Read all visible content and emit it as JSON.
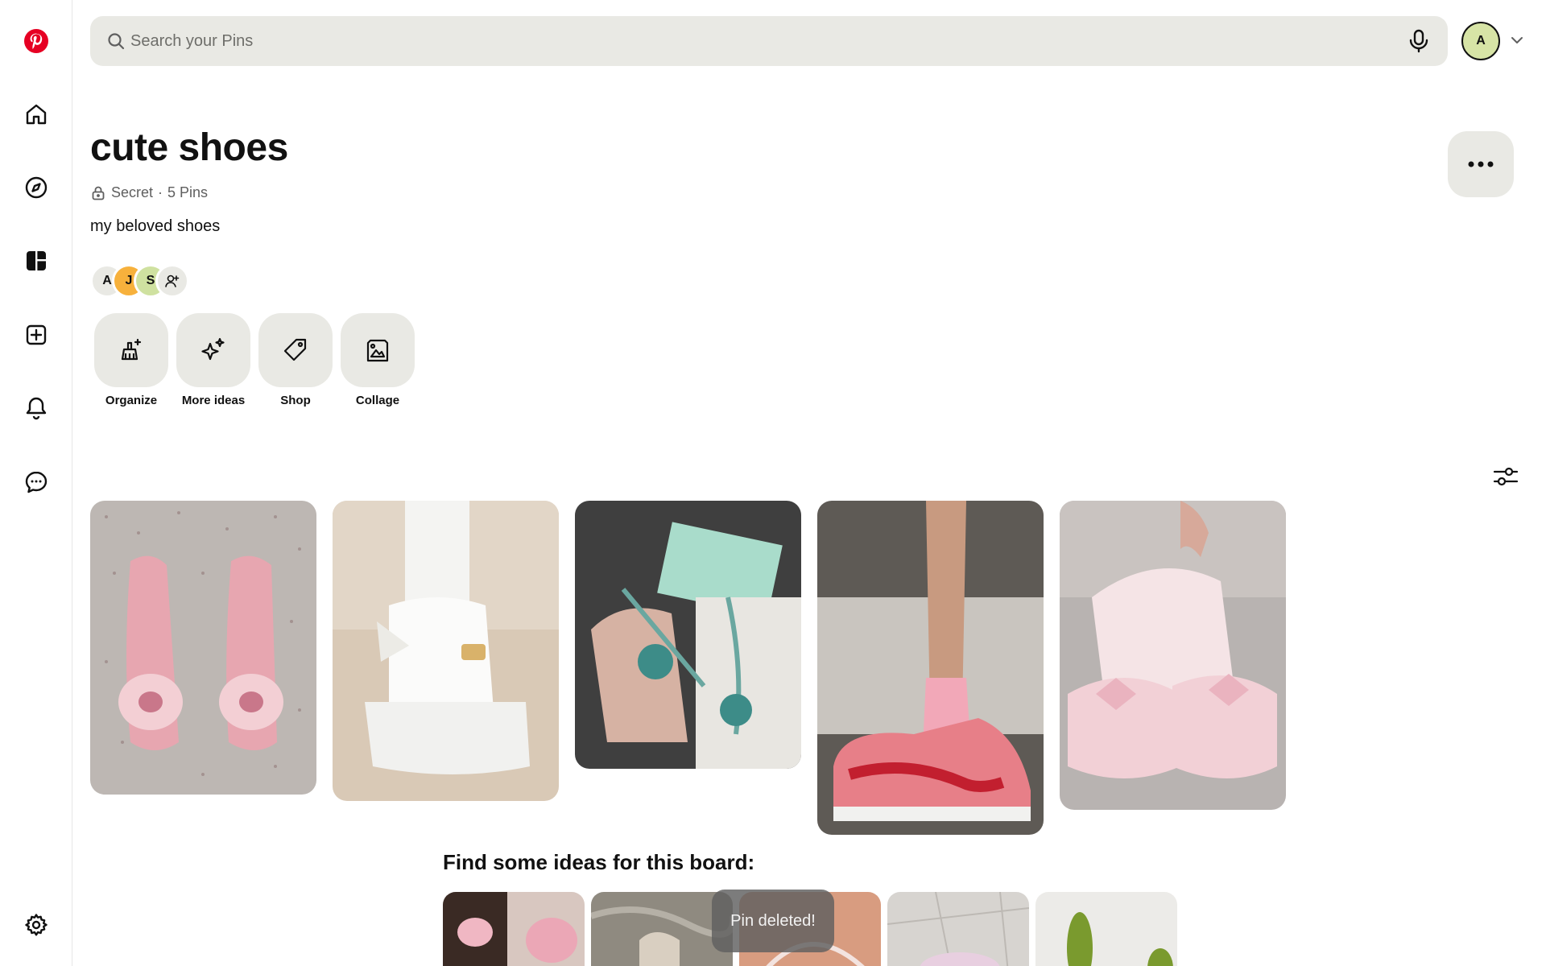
{
  "search": {
    "placeholder": "Search your Pins"
  },
  "account": {
    "initial": "A"
  },
  "board": {
    "title": "cute shoes",
    "visibility": "Secret",
    "separator": "·",
    "pin_count": "5 Pins",
    "description": "my beloved shoes"
  },
  "collaborators": [
    {
      "initial": "A",
      "color": "#e9e9e4"
    },
    {
      "initial": "J",
      "color": "#f7b13c"
    },
    {
      "initial": "S",
      "color": "#cfe1a0"
    }
  ],
  "tools": [
    {
      "label": "Organize",
      "icon": "broom-sparkle-icon"
    },
    {
      "label": "More ideas",
      "icon": "sparkle-icon"
    },
    {
      "label": "Shop",
      "icon": "tag-icon"
    },
    {
      "label": "Collage",
      "icon": "collage-icon"
    }
  ],
  "ideas": {
    "heading": "Find some ideas for this board:"
  },
  "toast": {
    "message": "Pin deleted!"
  },
  "colors": {
    "brand": "#e60023",
    "surface": "#e9e9e4"
  }
}
